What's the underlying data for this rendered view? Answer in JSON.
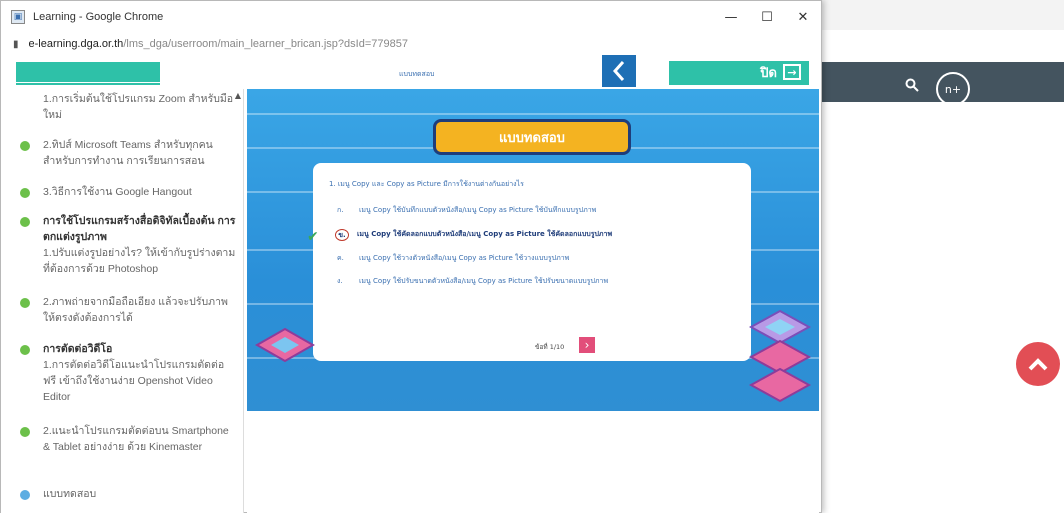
{
  "background_page": {
    "header_actions": [
      "⎘",
      "☆",
      "✱",
      "▢"
    ],
    "search_icon": "search-icon",
    "avatar_label": "n+"
  },
  "popup": {
    "title": "Learning - Google Chrome",
    "url_host": "e-learning.dga.or.th",
    "url_path": "/lms_dga/userroom/main_learner_brican.jsp?dsId=779857",
    "window_controls": [
      "—",
      "☐",
      "✕"
    ]
  },
  "topbar": {
    "center_label": "แบบทดสอบ",
    "close_label": "ปิด"
  },
  "sidebar": {
    "items": [
      {
        "type": "text",
        "text": "1.การเริ่มต้นใช้โปรแกรม Zoom สำหรับมือใหม่",
        "color": ""
      },
      {
        "type": "text",
        "text": "2.ทิปส์ Microsoft Teams สำหรับทุกคนสำหรับการทำงาน การเรียนการสอน",
        "color": "#6cc04a"
      },
      {
        "type": "text",
        "text": "3.วิธีการใช้งาน Google Hangout",
        "color": "#6cc04a"
      },
      {
        "type": "heading",
        "heading": "การใช้โปรแกรมสร้างสื่อดิจิทัลเบื้องต้น การตกแต่งรูปภาพ",
        "text": "1.ปรับแต่งรูปอย่างไร? ให้เข้ากับรูปร่างตามที่ต้องการด้วย Photoshop",
        "color": "#6cc04a"
      },
      {
        "type": "text",
        "text": "2.ภาพถ่ายจากมือถือเอียง แล้วจะปรับภาพให้ตรงดังต้องการได้",
        "color": "#6cc04a"
      },
      {
        "type": "heading",
        "heading": "การตัดต่อวิดีโอ",
        "text": "1.การตัดต่อวิดีโอแนะนำโปรแกรมตัดต่อ ฟรี เข้าถึงใช้งานง่าย Openshot Video Editor",
        "color": "#6cc04a"
      },
      {
        "type": "text",
        "text": "2.แนะนำโปรแกรมตัดต่อบน Smartphone & Tablet อย่างง่าย ด้วย Kinemaster",
        "color": "#6cc04a"
      },
      {
        "type": "text",
        "text": "แบบทดสอบ",
        "color": "#5dade2"
      }
    ]
  },
  "quiz": {
    "title": "แบบทดสอบ",
    "question": "1. เมนู Copy และ Copy as Picture มีการใช้งานต่างกันอย่างไร",
    "choices": [
      {
        "label": "ก.",
        "text": "เมนู Copy ใช้บันทึกแบบตัวหนังสือ/เมนู Copy as Picture ใช้บันทึกแบบรูปภาพ",
        "selected": false
      },
      {
        "label": "ข.",
        "text": "เมนู Copy ใช้คัดลอกแบบตัวหนังสือ/เมนู Copy as Picture ใช้คัดลอกแบบรูปภาพ",
        "selected": true
      },
      {
        "label": "ค.",
        "text": "เมนู Copy ใช้วางตัวหนังสือ/เมนู Copy as Picture ใช้วางแบบรูปภาพ",
        "selected": false
      },
      {
        "label": "ง.",
        "text": "เมนู Copy ใช้ปรับขนาดตัวหนังสือ/เมนู Copy as Picture ใช้ปรับขนาดแบบรูปภาพ",
        "selected": false
      }
    ],
    "pager": "ข้อที่ 1/10",
    "accent_color": "#f4b321"
  }
}
